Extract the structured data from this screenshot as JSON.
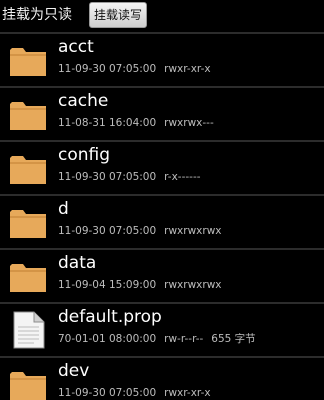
{
  "toolbar": {
    "readonly_label": "挂载为只读",
    "readwrite_label": "挂载读写"
  },
  "files": [
    {
      "name": "acct",
      "date": "11-09-30 07:05:00",
      "perms": "rwxr-xr-x",
      "size": "",
      "icon": "folder-icon"
    },
    {
      "name": "cache",
      "date": "11-08-31 16:04:00",
      "perms": "rwxrwx---",
      "size": "",
      "icon": "folder-icon"
    },
    {
      "name": "config",
      "date": "11-09-30 07:05:00",
      "perms": "r-x------",
      "size": "",
      "icon": "folder-icon"
    },
    {
      "name": "d",
      "date": "11-09-30 07:05:00",
      "perms": "rwxrwxrwx",
      "size": "",
      "icon": "folder-icon"
    },
    {
      "name": "data",
      "date": "11-09-04 15:09:00",
      "perms": "rwxrwxrwx",
      "size": "",
      "icon": "folder-icon"
    },
    {
      "name": "default.prop",
      "date": "70-01-01 08:00:00",
      "perms": "rw-r--r--",
      "size": "655 字节",
      "icon": "file-icon"
    },
    {
      "name": "dev",
      "date": "11-09-30 07:05:00",
      "perms": "rwxr-xr-x",
      "size": "",
      "icon": "folder-icon"
    }
  ],
  "colors": {
    "folder": "#e7a95a",
    "background": "#000000",
    "meta_text": "#bdbdbd"
  }
}
